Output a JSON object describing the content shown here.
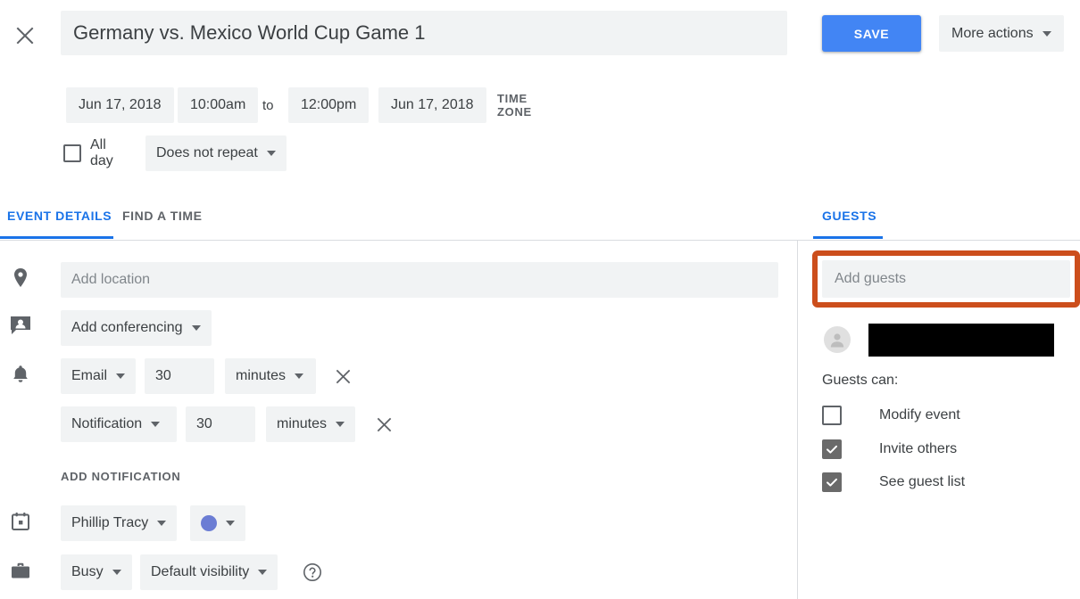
{
  "header": {
    "close_icon": "close-icon",
    "title_value": "Germany vs. Mexico World Cup Game 1",
    "title_placeholder": "Add title",
    "save_label": "SAVE",
    "more_actions_label": "More actions"
  },
  "schedule": {
    "start_date": "Jun 17, 2018",
    "start_time": "10:00am",
    "to_label": "to",
    "end_time": "12:00pm",
    "end_date": "Jun 17, 2018",
    "time_zone_label": "TIME ZONE",
    "all_day_label": "All day",
    "all_day_checked": false,
    "repeat_label": "Does not repeat"
  },
  "tabs": [
    {
      "label": "EVENT DETAILS",
      "active": true
    },
    {
      "label": "FIND A TIME",
      "active": false
    }
  ],
  "guests_tab": {
    "label": "GUESTS",
    "active": true
  },
  "event_details": {
    "location": {
      "icon": "location-pin-icon",
      "value": "",
      "placeholder": "Add location"
    },
    "conferencing": {
      "icon": "conferencing-icon",
      "label": "Add conferencing"
    },
    "notifications_icon": "bell-icon",
    "notifications": [
      {
        "type": "Email",
        "amount": "30",
        "unit": "minutes",
        "remove_icon": "close-icon"
      },
      {
        "type": "Notification",
        "amount": "30",
        "unit": "minutes",
        "remove_icon": "close-icon"
      }
    ],
    "add_notification_label": "ADD NOTIFICATION",
    "calendar": {
      "icon": "calendar-icon",
      "owner": "Phillip Tracy",
      "color_hex": "#6b7dd4"
    },
    "availability": {
      "icon": "briefcase-icon",
      "busy_label": "Busy",
      "visibility_label": "Default visibility",
      "help_icon": "help-circle-icon"
    }
  },
  "guests_panel": {
    "add_guests_placeholder": "Add guests",
    "add_guests_value": "",
    "highlight_color": "#cc4e1c",
    "guest_rows": [
      {
        "avatar_icon": "avatar-icon",
        "name_redacted": true
      }
    ],
    "guests_can_label": "Guests can:",
    "permissions": [
      {
        "label": "Modify event",
        "checked": false
      },
      {
        "label": "Invite others",
        "checked": true
      },
      {
        "label": "See guest list",
        "checked": true
      }
    ]
  },
  "colors": {
    "accent_blue": "#4285f4",
    "tab_blue": "#1a73e8",
    "chip_bg": "#f1f3f4",
    "text_primary": "#3c4043",
    "text_secondary": "#5f6368"
  }
}
